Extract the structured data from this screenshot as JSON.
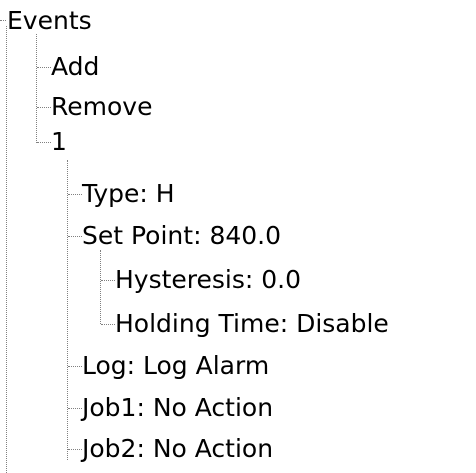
{
  "tree": {
    "root": {
      "label": "Events"
    },
    "items": [
      {
        "label": "Add"
      },
      {
        "label": "Remove"
      },
      {
        "label": "1"
      },
      {
        "label": "Type: H"
      },
      {
        "label": "Set Point: 840.0"
      },
      {
        "label": "Hysteresis: 0.0"
      },
      {
        "label": "Holding Time: Disable"
      },
      {
        "label": "Log: Log Alarm"
      },
      {
        "label": "Job1: No Action"
      },
      {
        "label": "Job2: No Action"
      }
    ],
    "line_color": "#808080",
    "text_color": "#000000",
    "background": "#ffffff"
  }
}
